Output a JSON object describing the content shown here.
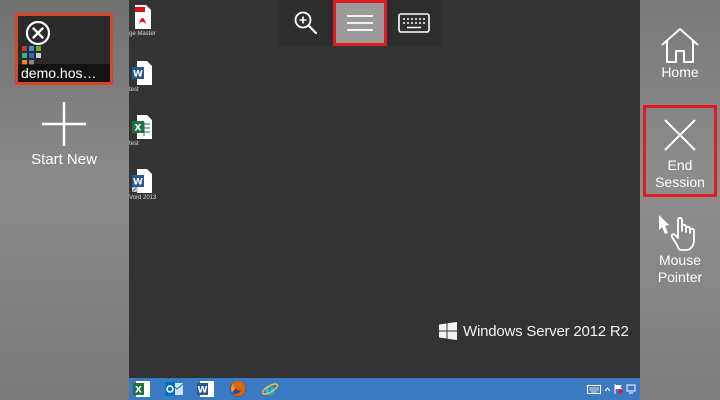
{
  "left_panel": {
    "session": {
      "label": "demo.hos…"
    },
    "start_new": {
      "label": "Start New"
    }
  },
  "desktop": {
    "icons": [
      {
        "caption": "ge Master",
        "type": "pdf-icon"
      },
      {
        "caption": "test",
        "type": "word-doc-icon"
      },
      {
        "caption": "test",
        "type": "excel-doc-icon"
      },
      {
        "caption": "Vord 2013",
        "type": "word-app-icon"
      }
    ],
    "brand": "Windows Server 2012 R2",
    "taskbar": {
      "apps": [
        "excel-icon",
        "outlook-icon",
        "word-icon",
        "firefox-icon",
        "internet-explorer-icon"
      ]
    }
  },
  "toolbar": {
    "zoom": "zoom-in-icon",
    "menu": "hamburger-menu-icon",
    "keyboard": "keyboard-icon"
  },
  "right_panel": {
    "home": {
      "label": "Home"
    },
    "end_session": {
      "line1": "End",
      "line2": "Session"
    },
    "mouse_pointer": {
      "line1": "Mouse",
      "line2": "Pointer"
    }
  },
  "colors": {
    "highlight": "#e01b24",
    "session_border": "#d6472b",
    "taskbar": "#3b79c3",
    "desktop": "#333333"
  }
}
